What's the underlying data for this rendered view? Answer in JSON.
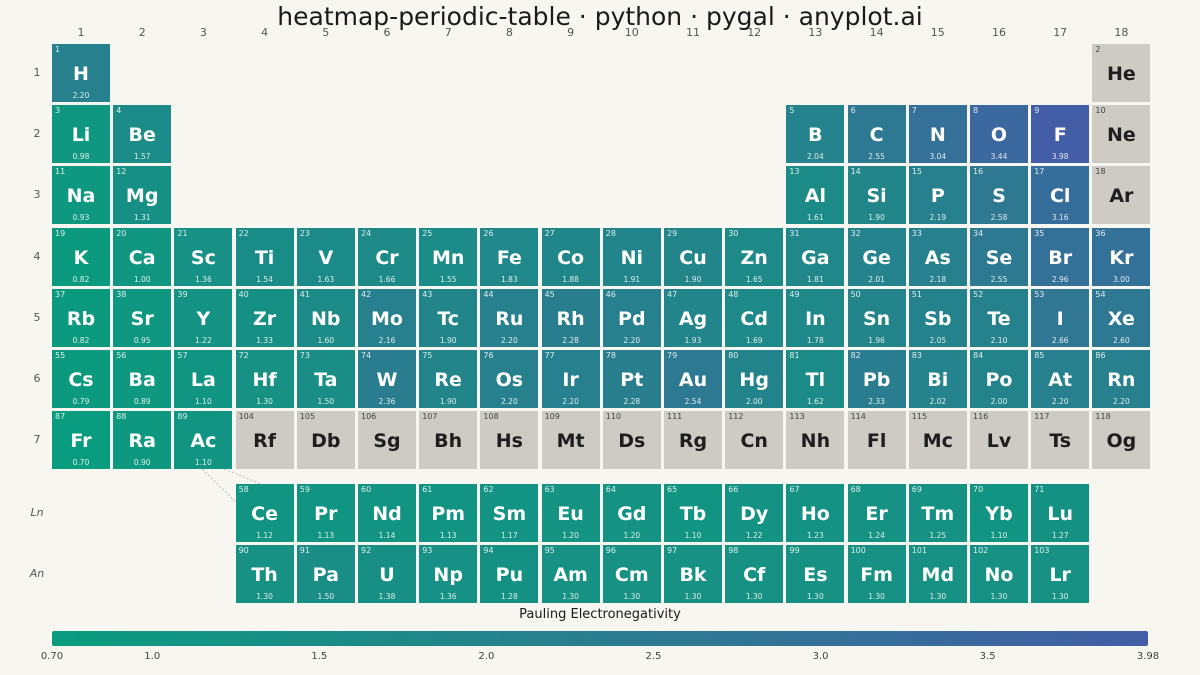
{
  "title": "heatmap-periodic-table · python · pygal · anyplot.ai",
  "colors": {
    "low": "#0a9c7e",
    "mid": "#2a7d8f",
    "high": "#435ea6",
    "nodata": "#cdcbc4",
    "background": "#f8f6f1"
  },
  "chart_data": {
    "type": "heatmap",
    "title": "heatmap-periodic-table · python · pygal · anyplot.ai",
    "colorbar_label": "Pauling Electronegativity",
    "value_range": [
      0.7,
      3.98
    ],
    "colorbar_ticks": [
      "0.70",
      "1.0",
      "1.5",
      "2.0",
      "2.5",
      "3.0",
      "3.5",
      "3.98"
    ],
    "group_labels": [
      "1",
      "2",
      "3",
      "4",
      "5",
      "6",
      "7",
      "8",
      "9",
      "10",
      "11",
      "12",
      "13",
      "14",
      "15",
      "16",
      "17",
      "18"
    ],
    "period_labels": [
      "1",
      "2",
      "3",
      "4",
      "5",
      "6",
      "7",
      "Ln",
      "An"
    ],
    "elements": [
      {
        "z": "1",
        "sym": "H",
        "en": "2.20",
        "row": 1,
        "col": 1
      },
      {
        "z": "2",
        "sym": "He",
        "en": null,
        "row": 1,
        "col": 18
      },
      {
        "z": "3",
        "sym": "Li",
        "en": "0.98",
        "row": 2,
        "col": 1
      },
      {
        "z": "4",
        "sym": "Be",
        "en": "1.57",
        "row": 2,
        "col": 2
      },
      {
        "z": "5",
        "sym": "B",
        "en": "2.04",
        "row": 2,
        "col": 13
      },
      {
        "z": "6",
        "sym": "C",
        "en": "2.55",
        "row": 2,
        "col": 14
      },
      {
        "z": "7",
        "sym": "N",
        "en": "3.04",
        "row": 2,
        "col": 15
      },
      {
        "z": "8",
        "sym": "O",
        "en": "3.44",
        "row": 2,
        "col": 16
      },
      {
        "z": "9",
        "sym": "F",
        "en": "3.98",
        "row": 2,
        "col": 17
      },
      {
        "z": "10",
        "sym": "Ne",
        "en": null,
        "row": 2,
        "col": 18
      },
      {
        "z": "11",
        "sym": "Na",
        "en": "0.93",
        "row": 3,
        "col": 1
      },
      {
        "z": "12",
        "sym": "Mg",
        "en": "1.31",
        "row": 3,
        "col": 2
      },
      {
        "z": "13",
        "sym": "Al",
        "en": "1.61",
        "row": 3,
        "col": 13
      },
      {
        "z": "14",
        "sym": "Si",
        "en": "1.90",
        "row": 3,
        "col": 14
      },
      {
        "z": "15",
        "sym": "P",
        "en": "2.19",
        "row": 3,
        "col": 15
      },
      {
        "z": "16",
        "sym": "S",
        "en": "2.58",
        "row": 3,
        "col": 16
      },
      {
        "z": "17",
        "sym": "Cl",
        "en": "3.16",
        "row": 3,
        "col": 17
      },
      {
        "z": "18",
        "sym": "Ar",
        "en": null,
        "row": 3,
        "col": 18
      },
      {
        "z": "19",
        "sym": "K",
        "en": "0.82",
        "row": 4,
        "col": 1
      },
      {
        "z": "20",
        "sym": "Ca",
        "en": "1.00",
        "row": 4,
        "col": 2
      },
      {
        "z": "21",
        "sym": "Sc",
        "en": "1.36",
        "row": 4,
        "col": 3
      },
      {
        "z": "22",
        "sym": "Ti",
        "en": "1.54",
        "row": 4,
        "col": 4
      },
      {
        "z": "23",
        "sym": "V",
        "en": "1.63",
        "row": 4,
        "col": 5
      },
      {
        "z": "24",
        "sym": "Cr",
        "en": "1.66",
        "row": 4,
        "col": 6
      },
      {
        "z": "25",
        "sym": "Mn",
        "en": "1.55",
        "row": 4,
        "col": 7
      },
      {
        "z": "26",
        "sym": "Fe",
        "en": "1.83",
        "row": 4,
        "col": 8
      },
      {
        "z": "27",
        "sym": "Co",
        "en": "1.88",
        "row": 4,
        "col": 9
      },
      {
        "z": "28",
        "sym": "Ni",
        "en": "1.91",
        "row": 4,
        "col": 10
      },
      {
        "z": "29",
        "sym": "Cu",
        "en": "1.90",
        "row": 4,
        "col": 11
      },
      {
        "z": "30",
        "sym": "Zn",
        "en": "1.65",
        "row": 4,
        "col": 12
      },
      {
        "z": "31",
        "sym": "Ga",
        "en": "1.81",
        "row": 4,
        "col": 13
      },
      {
        "z": "32",
        "sym": "Ge",
        "en": "2.01",
        "row": 4,
        "col": 14
      },
      {
        "z": "33",
        "sym": "As",
        "en": "2.18",
        "row": 4,
        "col": 15
      },
      {
        "z": "34",
        "sym": "Se",
        "en": "2.55",
        "row": 4,
        "col": 16
      },
      {
        "z": "35",
        "sym": "Br",
        "en": "2.96",
        "row": 4,
        "col": 17
      },
      {
        "z": "36",
        "sym": "Kr",
        "en": "3.00",
        "row": 4,
        "col": 18
      },
      {
        "z": "37",
        "sym": "Rb",
        "en": "0.82",
        "row": 5,
        "col": 1
      },
      {
        "z": "38",
        "sym": "Sr",
        "en": "0.95",
        "row": 5,
        "col": 2
      },
      {
        "z": "39",
        "sym": "Y",
        "en": "1.22",
        "row": 5,
        "col": 3
      },
      {
        "z": "40",
        "sym": "Zr",
        "en": "1.33",
        "row": 5,
        "col": 4
      },
      {
        "z": "41",
        "sym": "Nb",
        "en": "1.60",
        "row": 5,
        "col": 5
      },
      {
        "z": "42",
        "sym": "Mo",
        "en": "2.16",
        "row": 5,
        "col": 6
      },
      {
        "z": "43",
        "sym": "Tc",
        "en": "1.90",
        "row": 5,
        "col": 7
      },
      {
        "z": "44",
        "sym": "Ru",
        "en": "2.20",
        "row": 5,
        "col": 8
      },
      {
        "z": "45",
        "sym": "Rh",
        "en": "2.28",
        "row": 5,
        "col": 9
      },
      {
        "z": "46",
        "sym": "Pd",
        "en": "2.20",
        "row": 5,
        "col": 10
      },
      {
        "z": "47",
        "sym": "Ag",
        "en": "1.93",
        "row": 5,
        "col": 11
      },
      {
        "z": "48",
        "sym": "Cd",
        "en": "1.69",
        "row": 5,
        "col": 12
      },
      {
        "z": "49",
        "sym": "In",
        "en": "1.78",
        "row": 5,
        "col": 13
      },
      {
        "z": "50",
        "sym": "Sn",
        "en": "1.96",
        "row": 5,
        "col": 14
      },
      {
        "z": "51",
        "sym": "Sb",
        "en": "2.05",
        "row": 5,
        "col": 15
      },
      {
        "z": "52",
        "sym": "Te",
        "en": "2.10",
        "row": 5,
        "col": 16
      },
      {
        "z": "53",
        "sym": "I",
        "en": "2.66",
        "row": 5,
        "col": 17
      },
      {
        "z": "54",
        "sym": "Xe",
        "en": "2.60",
        "row": 5,
        "col": 18
      },
      {
        "z": "55",
        "sym": "Cs",
        "en": "0.79",
        "row": 6,
        "col": 1
      },
      {
        "z": "56",
        "sym": "Ba",
        "en": "0.89",
        "row": 6,
        "col": 2
      },
      {
        "z": "57",
        "sym": "La",
        "en": "1.10",
        "row": 6,
        "col": 3
      },
      {
        "z": "72",
        "sym": "Hf",
        "en": "1.30",
        "row": 6,
        "col": 4
      },
      {
        "z": "73",
        "sym": "Ta",
        "en": "1.50",
        "row": 6,
        "col": 5
      },
      {
        "z": "74",
        "sym": "W",
        "en": "2.36",
        "row": 6,
        "col": 6
      },
      {
        "z": "75",
        "sym": "Re",
        "en": "1.90",
        "row": 6,
        "col": 7
      },
      {
        "z": "76",
        "sym": "Os",
        "en": "2.20",
        "row": 6,
        "col": 8
      },
      {
        "z": "77",
        "sym": "Ir",
        "en": "2.20",
        "row": 6,
        "col": 9
      },
      {
        "z": "78",
        "sym": "Pt",
        "en": "2.28",
        "row": 6,
        "col": 10
      },
      {
        "z": "79",
        "sym": "Au",
        "en": "2.54",
        "row": 6,
        "col": 11
      },
      {
        "z": "80",
        "sym": "Hg",
        "en": "2.00",
        "row": 6,
        "col": 12
      },
      {
        "z": "81",
        "sym": "Tl",
        "en": "1.62",
        "row": 6,
        "col": 13
      },
      {
        "z": "82",
        "sym": "Pb",
        "en": "2.33",
        "row": 6,
        "col": 14
      },
      {
        "z": "83",
        "sym": "Bi",
        "en": "2.02",
        "row": 6,
        "col": 15
      },
      {
        "z": "84",
        "sym": "Po",
        "en": "2.00",
        "row": 6,
        "col": 16
      },
      {
        "z": "85",
        "sym": "At",
        "en": "2.20",
        "row": 6,
        "col": 17
      },
      {
        "z": "86",
        "sym": "Rn",
        "en": "2.20",
        "row": 6,
        "col": 18
      },
      {
        "z": "87",
        "sym": "Fr",
        "en": "0.70",
        "row": 7,
        "col": 1
      },
      {
        "z": "88",
        "sym": "Ra",
        "en": "0.90",
        "row": 7,
        "col": 2
      },
      {
        "z": "89",
        "sym": "Ac",
        "en": "1.10",
        "row": 7,
        "col": 3
      },
      {
        "z": "104",
        "sym": "Rf",
        "en": null,
        "row": 7,
        "col": 4
      },
      {
        "z": "105",
        "sym": "Db",
        "en": null,
        "row": 7,
        "col": 5
      },
      {
        "z": "106",
        "sym": "Sg",
        "en": null,
        "row": 7,
        "col": 6
      },
      {
        "z": "107",
        "sym": "Bh",
        "en": null,
        "row": 7,
        "col": 7
      },
      {
        "z": "108",
        "sym": "Hs",
        "en": null,
        "row": 7,
        "col": 8
      },
      {
        "z": "109",
        "sym": "Mt",
        "en": null,
        "row": 7,
        "col": 9
      },
      {
        "z": "110",
        "sym": "Ds",
        "en": null,
        "row": 7,
        "col": 10
      },
      {
        "z": "111",
        "sym": "Rg",
        "en": null,
        "row": 7,
        "col": 11
      },
      {
        "z": "112",
        "sym": "Cn",
        "en": null,
        "row": 7,
        "col": 12
      },
      {
        "z": "113",
        "sym": "Nh",
        "en": null,
        "row": 7,
        "col": 13
      },
      {
        "z": "114",
        "sym": "Fl",
        "en": null,
        "row": 7,
        "col": 14
      },
      {
        "z": "115",
        "sym": "Mc",
        "en": null,
        "row": 7,
        "col": 15
      },
      {
        "z": "116",
        "sym": "Lv",
        "en": null,
        "row": 7,
        "col": 16
      },
      {
        "z": "117",
        "sym": "Ts",
        "en": null,
        "row": 7,
        "col": 17
      },
      {
        "z": "118",
        "sym": "Og",
        "en": null,
        "row": 7,
        "col": 18
      },
      {
        "z": "58",
        "sym": "Ce",
        "en": "1.12",
        "row": 8,
        "col": 4
      },
      {
        "z": "59",
        "sym": "Pr",
        "en": "1.13",
        "row": 8,
        "col": 5
      },
      {
        "z": "60",
        "sym": "Nd",
        "en": "1.14",
        "row": 8,
        "col": 6
      },
      {
        "z": "61",
        "sym": "Pm",
        "en": "1.13",
        "row": 8,
        "col": 7
      },
      {
        "z": "62",
        "sym": "Sm",
        "en": "1.17",
        "row": 8,
        "col": 8
      },
      {
        "z": "63",
        "sym": "Eu",
        "en": "1.20",
        "row": 8,
        "col": 9
      },
      {
        "z": "64",
        "sym": "Gd",
        "en": "1.20",
        "row": 8,
        "col": 10
      },
      {
        "z": "65",
        "sym": "Tb",
        "en": "1.10",
        "row": 8,
        "col": 11
      },
      {
        "z": "66",
        "sym": "Dy",
        "en": "1.22",
        "row": 8,
        "col": 12
      },
      {
        "z": "67",
        "sym": "Ho",
        "en": "1.23",
        "row": 8,
        "col": 13
      },
      {
        "z": "68",
        "sym": "Er",
        "en": "1.24",
        "row": 8,
        "col": 14
      },
      {
        "z": "69",
        "sym": "Tm",
        "en": "1.25",
        "row": 8,
        "col": 15
      },
      {
        "z": "70",
        "sym": "Yb",
        "en": "1.10",
        "row": 8,
        "col": 16
      },
      {
        "z": "71",
        "sym": "Lu",
        "en": "1.27",
        "row": 8,
        "col": 17
      },
      {
        "z": "90",
        "sym": "Th",
        "en": "1.30",
        "row": 9,
        "col": 4
      },
      {
        "z": "91",
        "sym": "Pa",
        "en": "1.50",
        "row": 9,
        "col": 5
      },
      {
        "z": "92",
        "sym": "U",
        "en": "1.38",
        "row": 9,
        "col": 6
      },
      {
        "z": "93",
        "sym": "Np",
        "en": "1.36",
        "row": 9,
        "col": 7
      },
      {
        "z": "94",
        "sym": "Pu",
        "en": "1.28",
        "row": 9,
        "col": 8
      },
      {
        "z": "95",
        "sym": "Am",
        "en": "1.30",
        "row": 9,
        "col": 9
      },
      {
        "z": "96",
        "sym": "Cm",
        "en": "1.30",
        "row": 9,
        "col": 10
      },
      {
        "z": "97",
        "sym": "Bk",
        "en": "1.30",
        "row": 9,
        "col": 11
      },
      {
        "z": "98",
        "sym": "Cf",
        "en": "1.30",
        "row": 9,
        "col": 12
      },
      {
        "z": "99",
        "sym": "Es",
        "en": "1.30",
        "row": 9,
        "col": 13
      },
      {
        "z": "100",
        "sym": "Fm",
        "en": "1.30",
        "row": 9,
        "col": 14
      },
      {
        "z": "101",
        "sym": "Md",
        "en": "1.30",
        "row": 9,
        "col": 15
      },
      {
        "z": "102",
        "sym": "No",
        "en": "1.30",
        "row": 9,
        "col": 16
      },
      {
        "z": "103",
        "sym": "Lr",
        "en": "1.30",
        "row": 9,
        "col": 17
      }
    ]
  }
}
